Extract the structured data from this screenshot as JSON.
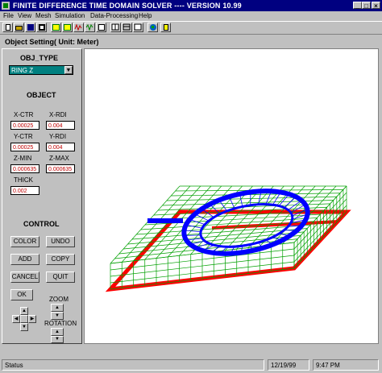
{
  "window": {
    "title": "FINITE DIFFERENCE TIME DOMAIN SOLVER ---- VERSION 10.99"
  },
  "menu": [
    "File",
    "View",
    "Mesh",
    "Simulation",
    "Data-Processing",
    "Help"
  ],
  "toolbar_icons": [
    "new-icon",
    "open-icon",
    "save-icon",
    "print-icon",
    "mesh-view-icon",
    "mesh-alt-icon",
    "waveform-icon",
    "signal-icon",
    "field-icon",
    "grid-view-icon",
    "table-icon",
    "layout-icon",
    "globe-icon",
    "info-icon"
  ],
  "panel": {
    "title": "Object Setting( Unit: Meter)",
    "obj_type_header": "OBJ_TYPE",
    "obj_type_selected": "RING Z",
    "object_header": "OBJECT",
    "fields": {
      "x_ctr": {
        "label": "X-CTR",
        "value": "0.00025"
      },
      "x_rdi": {
        "label": "X-RDI",
        "value": "0.004"
      },
      "y_ctr": {
        "label": "Y-CTR",
        "value": "0.00025"
      },
      "y_rdi": {
        "label": "Y-RDI",
        "value": "0.004"
      },
      "z_min": {
        "label": "Z-MIN",
        "value": "0.000635"
      },
      "z_max": {
        "label": "Z-MAX",
        "value": "0.000635"
      },
      "thick": {
        "label": "THICK",
        "value": "0.002"
      }
    },
    "control_header": "CONTROL",
    "buttons": {
      "color": "COLOR",
      "undo": "UNDO",
      "add": "ADD",
      "copy": "COPY",
      "cancel": "CANCEL",
      "quit": "QUIT",
      "ok": "OK"
    },
    "zoom_label": "ZOOM",
    "rotation_label": "ROTATION"
  },
  "status": {
    "text": "Status",
    "date": "12/19/99",
    "time": "9:47 PM"
  },
  "colors": {
    "title_bg": "#000080",
    "face": "#c0c0c0",
    "select_bg": "#008080",
    "field_text": "#c00000",
    "mesh": "#00a000",
    "ring": "#0000ff",
    "ground": "#ff0000"
  }
}
